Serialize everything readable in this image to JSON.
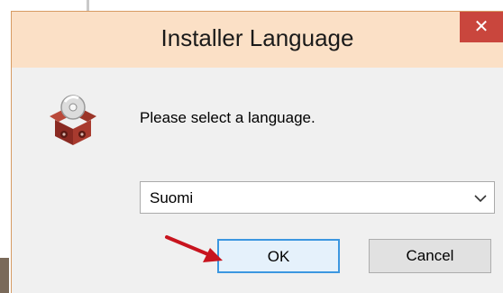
{
  "dialog": {
    "title": "Installer Language",
    "close_label": "✕",
    "prompt": "Please select a language.",
    "language_select": {
      "selected": "Suomi"
    },
    "ok_label": "OK",
    "cancel_label": "Cancel"
  },
  "colors": {
    "titlebar": "#fbe0c6",
    "close_button": "#c9463d",
    "ok_border": "#3c97e0",
    "annotation_arrow": "#c8141e"
  },
  "icons": {
    "app": "installer-box-icon",
    "dropdown": "chevron-down-icon",
    "annotation": "red-arrow-icon"
  }
}
